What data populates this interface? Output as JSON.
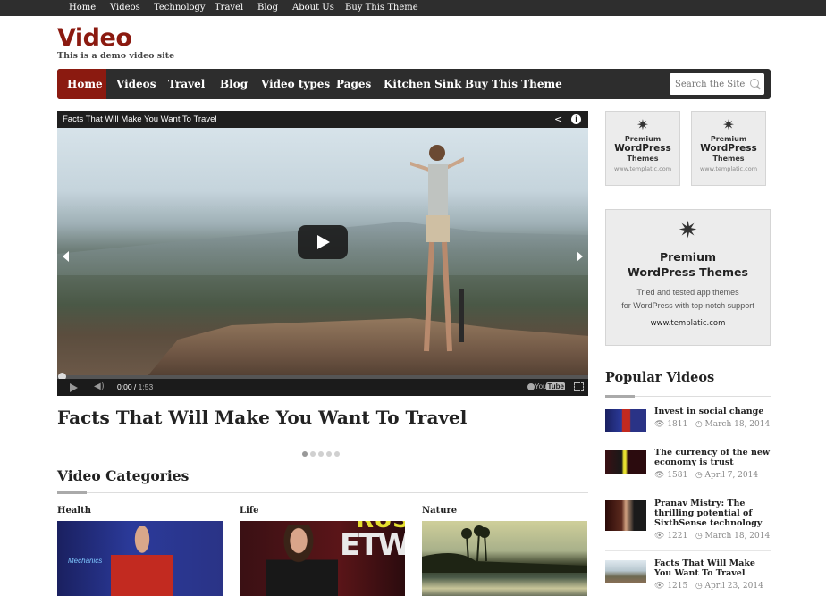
{
  "top_nav": {
    "items": [
      {
        "label": "Home"
      },
      {
        "label": "Videos"
      },
      {
        "label": "Technology"
      },
      {
        "label": "Travel"
      },
      {
        "label": "Blog"
      },
      {
        "label": "About Us"
      },
      {
        "label": "Buy This Theme"
      }
    ]
  },
  "site": {
    "title": "Video",
    "tagline": "This is a demo video site",
    "brand_color": "#8b1a10"
  },
  "main_nav": {
    "items": [
      {
        "label": "Home",
        "active": true
      },
      {
        "label": "Videos"
      },
      {
        "label": "Travel"
      },
      {
        "label": "Blog"
      },
      {
        "label": "Video types"
      },
      {
        "label": "Pages"
      },
      {
        "label": "Kitchen Sink"
      },
      {
        "label": "Buy This Theme"
      }
    ],
    "search": {
      "placeholder": "Search the Site...",
      "icon": "search-icon"
    }
  },
  "player": {
    "title": "Facts That Will Make You Want To Travel",
    "current_time": "0:00",
    "duration": "1:53",
    "progress_fraction": 0,
    "icons": [
      "share-icon",
      "info-icon",
      "play-icon",
      "volume-icon",
      "settings-icon",
      "youtube-logo",
      "fullscreen-icon"
    ],
    "youtube_label": "You",
    "youtube_label_box": "Tube"
  },
  "featured": {
    "title": "Facts That Will Make You Want To Travel",
    "slides_total": 5,
    "slide_active": 1
  },
  "video_categories": {
    "title": "Video Categories",
    "items": [
      {
        "label": "Health",
        "thumb_text": "Mechanics"
      },
      {
        "label": "Life",
        "thumb_text": "ETW",
        "thumb_text_top": "RUS"
      },
      {
        "label": "Nature"
      }
    ]
  },
  "ads": {
    "small": [
      {
        "line1": "Premium",
        "line2": "WordPress",
        "line3": "Themes",
        "url": "www.templatic.com"
      },
      {
        "line1": "Premium",
        "line2": "WordPress",
        "line3": "Themes",
        "url": "www.templatic.com"
      }
    ],
    "big": {
      "line1": "Premium",
      "line2": "WordPress Themes",
      "desc1": "Tried and tested app themes",
      "desc2": "for WordPress with top-notch support",
      "url": "www.templatic.com"
    },
    "star_glyph": "✷"
  },
  "popular_videos": {
    "title": "Popular Videos",
    "items": [
      {
        "title": "Invest in social change",
        "views": "1811",
        "date": "March 18, 2014"
      },
      {
        "title": "The currency of the new economy is trust",
        "views": "1581",
        "date": "April 7, 2014"
      },
      {
        "title": "Pranav Mistry: The thrilling potential of SixthSense technology",
        "views": "1221",
        "date": "March 18, 2014"
      },
      {
        "title": "Facts That Will Make You Want To Travel",
        "views": "1215",
        "date": "April 23, 2014"
      }
    ],
    "view_icon_glyph": "👁",
    "clock_icon_glyph": "◷"
  }
}
